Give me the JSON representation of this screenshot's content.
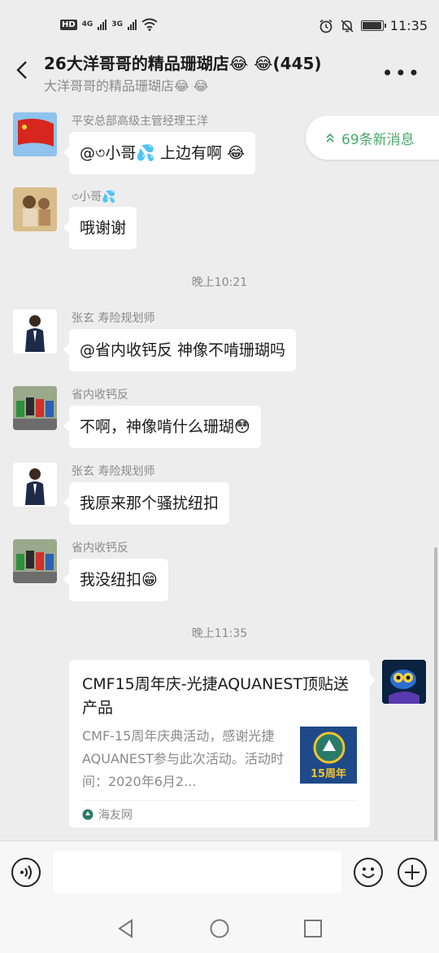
{
  "status_bar": {
    "network_left": "4G",
    "network_right": "3G",
    "time": "11:35",
    "battery_level": 0.9
  },
  "header": {
    "title": "26大洋哥哥的精品珊瑚店😂 😂(445)",
    "subtitle": "大洋哥哥的精品珊瑚店😂 😂"
  },
  "new_messages": {
    "label": "69条新消息"
  },
  "messages": [
    {
      "sender": "平安总部高级主管经理王洋",
      "text_before": "@৩小哥💦 上边有啊",
      "emoji": "😂"
    },
    {
      "sender": "৩小哥💦",
      "text": "哦谢谢"
    },
    {
      "time": "晚上10:21"
    },
    {
      "sender": "张玄 寿险规划师",
      "text": "@省内收钙反  神像不啃珊瑚吗"
    },
    {
      "sender": "省内收钙反",
      "text": "不啊，神像啃什么珊瑚😳"
    },
    {
      "sender": "张玄 寿险规划师",
      "text": "我原来那个骚扰纽扣"
    },
    {
      "sender": "省内收钙反",
      "text": "我没纽扣😁"
    },
    {
      "time": "晚上11:35"
    }
  ],
  "share_card": {
    "title": "CMF15周年庆-光捷AQUANEST顶贴送产品",
    "description": "CMF-15周年庆典活动，感谢光捷AQUANEST参与此次活动。活动时间：2020年6月2...",
    "thumb_text": "15周年",
    "source": "海友网"
  },
  "input": {
    "placeholder": ""
  }
}
